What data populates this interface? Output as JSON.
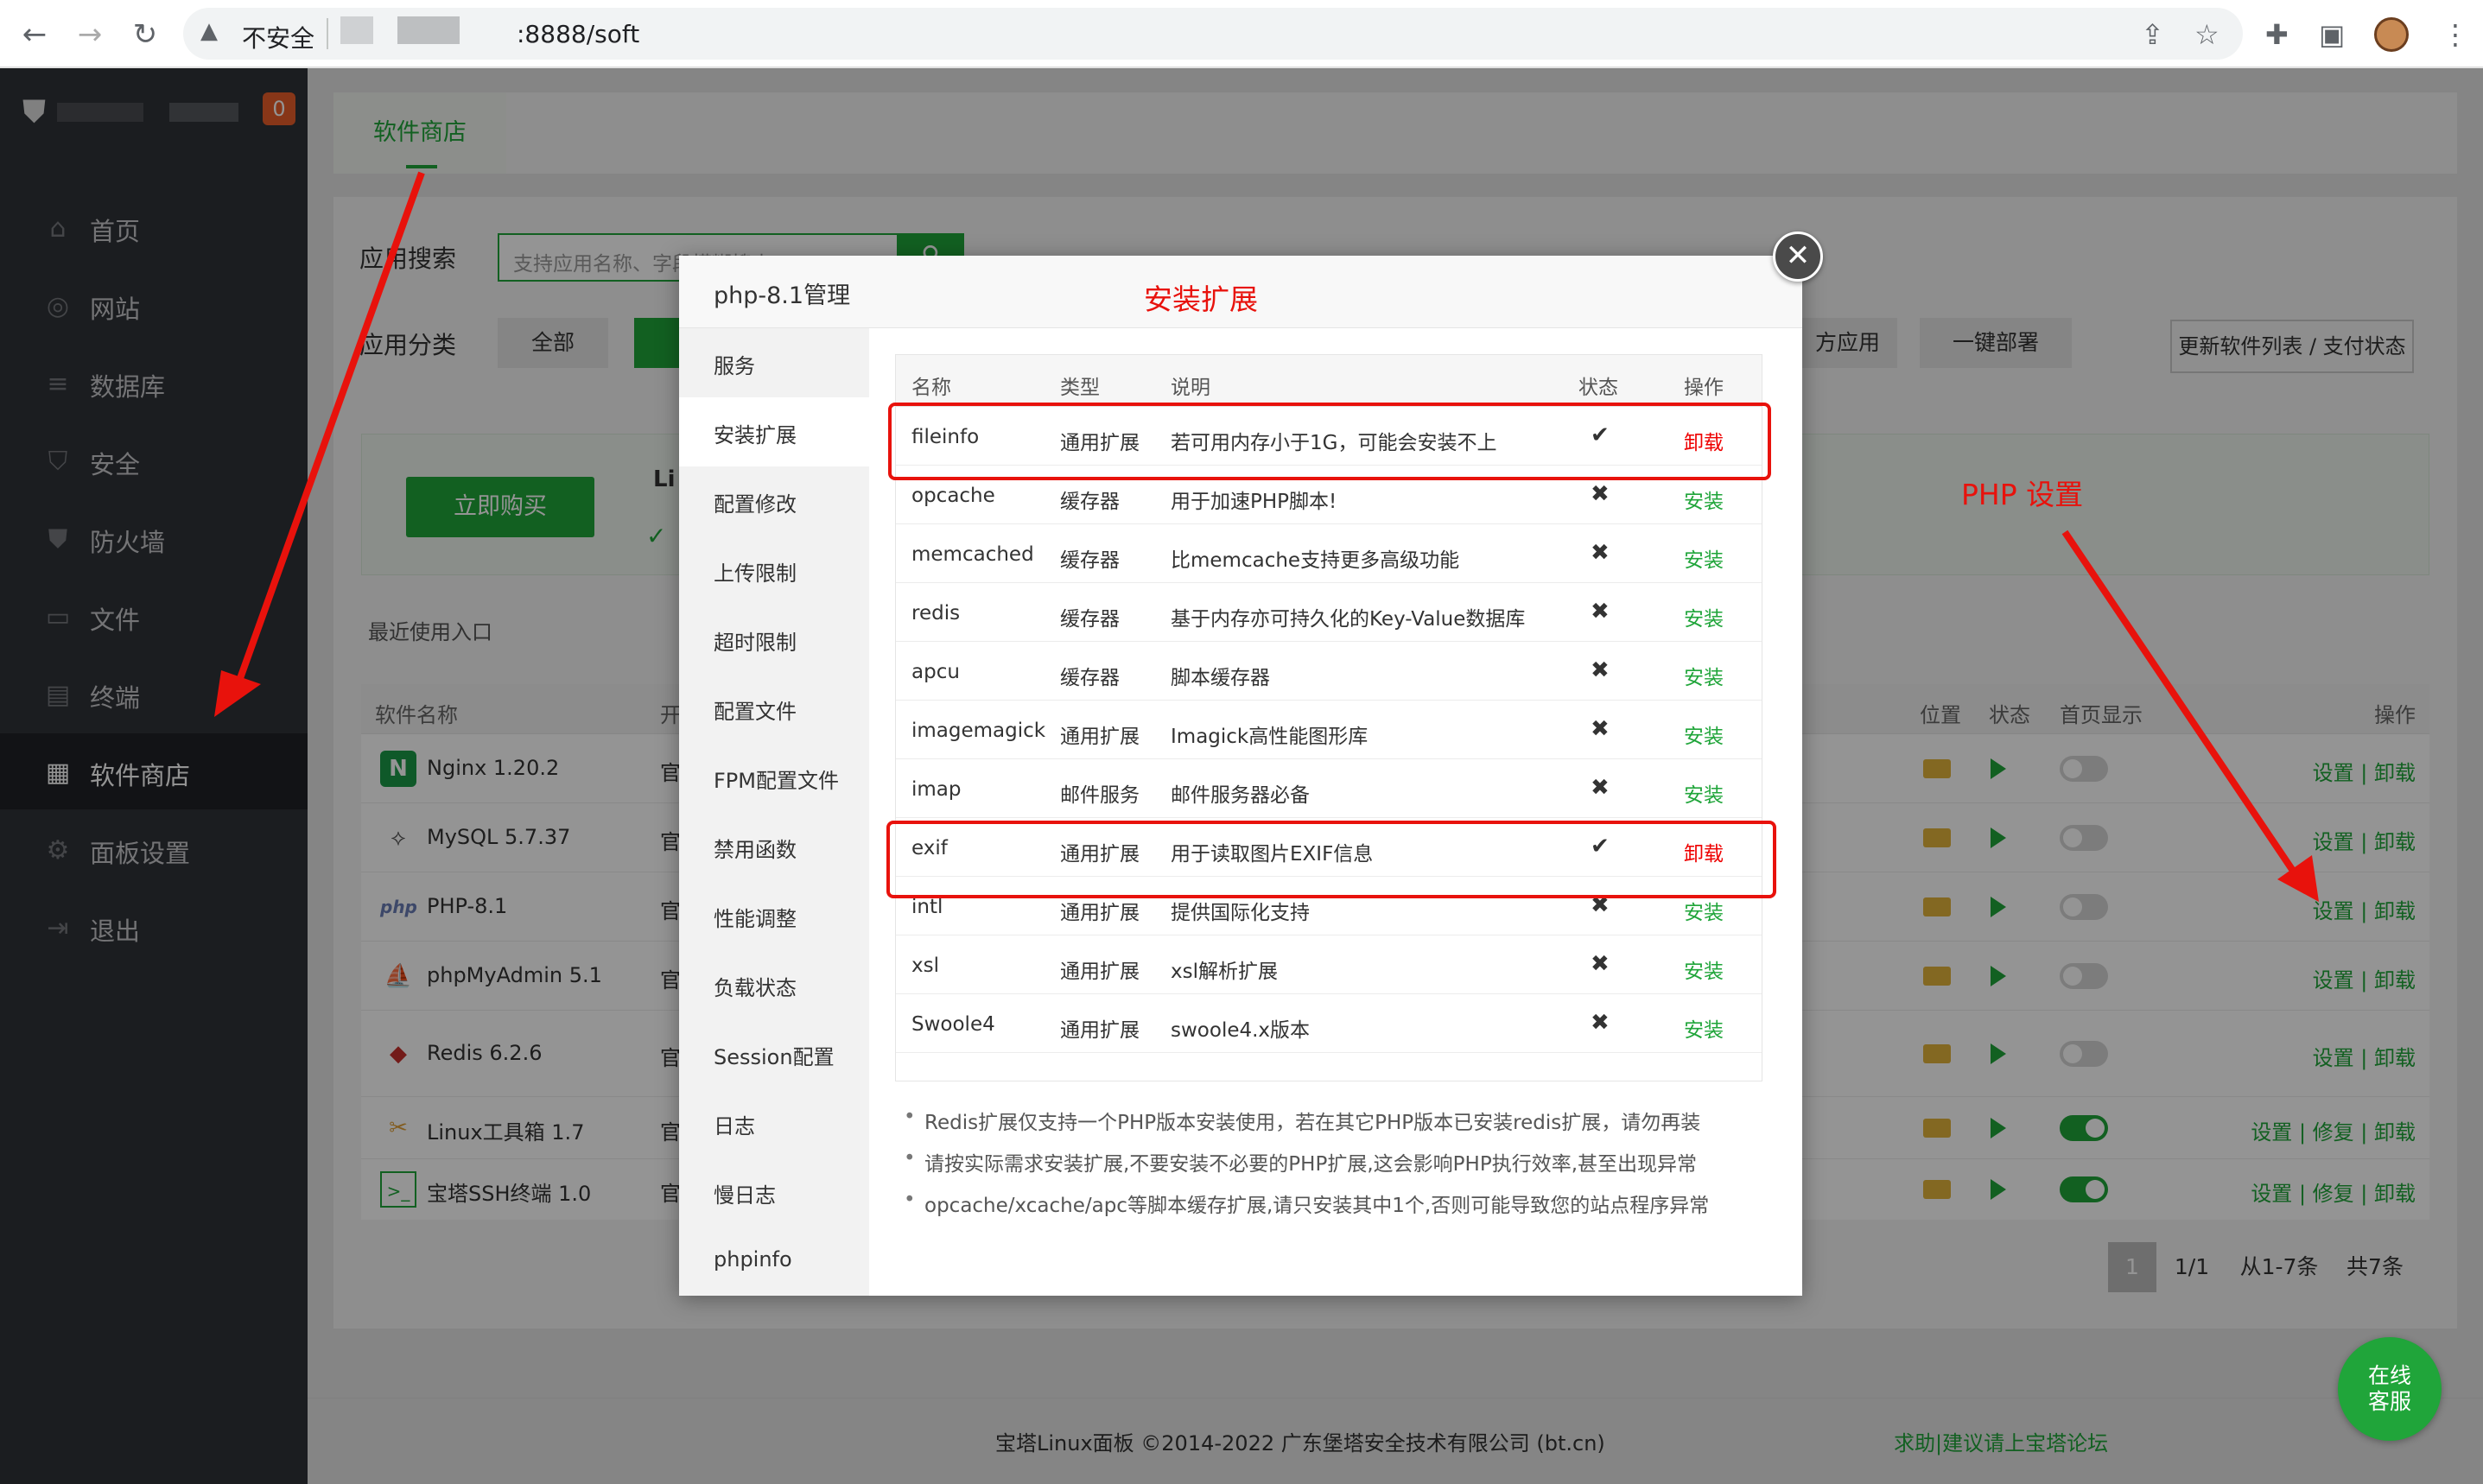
{
  "browser": {
    "insecure_label": "不安全",
    "url": ":8888/soft"
  },
  "sidebar": {
    "badge": "0",
    "items": [
      {
        "label": "首页",
        "icon": "home-icon"
      },
      {
        "label": "网站",
        "icon": "globe-icon"
      },
      {
        "label": "数据库",
        "icon": "database-icon"
      },
      {
        "label": "安全",
        "icon": "shield-icon"
      },
      {
        "label": "防火墙",
        "icon": "firewall-icon"
      },
      {
        "label": "文件",
        "icon": "folder-icon"
      },
      {
        "label": "终端",
        "icon": "terminal-icon"
      },
      {
        "label": "软件商店",
        "icon": "grid-icon",
        "active": true
      },
      {
        "label": "面板设置",
        "icon": "gear-icon"
      },
      {
        "label": "退出",
        "icon": "logout-icon"
      }
    ]
  },
  "main": {
    "tab": "软件商店",
    "search_label": "应用搜索",
    "search_placeholder": "支持应用名称、字段模糊搜索",
    "category_label": "应用分类",
    "category_all": "全部",
    "category_third": "方应用",
    "category_deploy": "一键部署",
    "update_button": "更新软件列表 / 支付状态",
    "buy_button": "立即购买",
    "promo_prefix": "Li",
    "recent_label": "最近使用入口",
    "table_headers": {
      "name": "软件名称",
      "dev": "开",
      "location": "位置",
      "status": "状态",
      "homepage": "首页显示",
      "ops": "操作"
    },
    "software": [
      {
        "name": "Nginx 1.20.2",
        "org": "官",
        "icon": "nginx-icon",
        "toggle_on": false,
        "ops": "设置 | 卸载"
      },
      {
        "name": "MySQL 5.7.37",
        "org": "官",
        "icon": "mysql-icon",
        "toggle_on": false,
        "ops": "设置 | 卸载"
      },
      {
        "name": "PHP-8.1",
        "org": "官",
        "icon": "php-icon",
        "toggle_on": false,
        "ops": "设置 | 卸载"
      },
      {
        "name": "phpMyAdmin 5.1",
        "org": "官",
        "icon": "phpmyadmin-icon",
        "toggle_on": false,
        "ops": "设置 | 卸载"
      },
      {
        "name": "Redis 6.2.6",
        "org": "官",
        "icon": "redis-icon",
        "toggle_on": false,
        "ops": "设置 | 卸载"
      },
      {
        "name": "Linux工具箱 1.7",
        "org": "官",
        "icon": "toolbox-icon",
        "toggle_on": true,
        "ops": "设置 | 修复 | 卸载"
      },
      {
        "name": "宝塔SSH终端 1.0",
        "org": "官",
        "icon": "terminal-icon",
        "toggle_on": true,
        "ops": "设置 | 修复 | 卸载"
      }
    ],
    "pager": {
      "current": "1",
      "pages": "1/1",
      "range": "从1-7条",
      "total": "共7条"
    }
  },
  "footer": {
    "copyright": "宝塔Linux面板 ©2014-2022 广东堡塔安全技术有限公司 (bt.cn)",
    "link": "求助|建议请上宝塔论坛"
  },
  "chat": {
    "line1": "在线",
    "line2": "客服"
  },
  "modal": {
    "title": "php-8.1管理",
    "close": "×",
    "nav": [
      "服务",
      "安装扩展",
      "配置修改",
      "上传限制",
      "超时限制",
      "配置文件",
      "FPM配置文件",
      "禁用函数",
      "性能调整",
      "负载状态",
      "Session配置",
      "日志",
      "慢日志",
      "phpinfo"
    ],
    "active_nav": "安装扩展",
    "headers": {
      "name": "名称",
      "type": "类型",
      "desc": "说明",
      "status": "状态",
      "op": "操作"
    },
    "extensions": [
      {
        "name": "fileinfo",
        "type": "通用扩展",
        "desc": "若可用内存小于1G，可能会安装不上",
        "installed": true,
        "status": "✔",
        "op": "卸载"
      },
      {
        "name": "opcache",
        "type": "缓存器",
        "desc": "用于加速PHP脚本!",
        "installed": false,
        "status": "✖",
        "op": "安装"
      },
      {
        "name": "memcached",
        "type": "缓存器",
        "desc": "比memcache支持更多高级功能",
        "installed": false,
        "status": "✖",
        "op": "安装"
      },
      {
        "name": "redis",
        "type": "缓存器",
        "desc": "基于内存亦可持久化的Key-Value数据库",
        "installed": false,
        "status": "✖",
        "op": "安装"
      },
      {
        "name": "apcu",
        "type": "缓存器",
        "desc": "脚本缓存器",
        "installed": false,
        "status": "✖",
        "op": "安装"
      },
      {
        "name": "imagemagick",
        "type": "通用扩展",
        "desc": "Imagick高性能图形库",
        "installed": false,
        "status": "✖",
        "op": "安装"
      },
      {
        "name": "imap",
        "type": "邮件服务",
        "desc": "邮件服务器必备",
        "installed": false,
        "status": "✖",
        "op": "安装"
      },
      {
        "name": "exif",
        "type": "通用扩展",
        "desc": "用于读取图片EXIF信息",
        "installed": true,
        "status": "✔",
        "op": "卸载"
      },
      {
        "name": "intl",
        "type": "通用扩展",
        "desc": "提供国际化支持",
        "installed": false,
        "status": "✖",
        "op": "安装"
      },
      {
        "name": "xsl",
        "type": "通用扩展",
        "desc": "xsl解析扩展",
        "installed": false,
        "status": "✖",
        "op": "安装"
      },
      {
        "name": "Swoole4",
        "type": "通用扩展",
        "desc": "swoole4.x版本",
        "installed": false,
        "status": "✖",
        "op": "安装"
      }
    ],
    "tips": [
      "Redis扩展仅支持一个PHP版本安装使用，若在其它PHP版本已安装redis扩展，请勿再装",
      "请按实际需求安装扩展,不要安装不必要的PHP扩展,这会影响PHP执行效率,甚至出现异常",
      "opcache/xcache/apc等脚本缓存扩展,请只安装其中1个,否则可能导致您的站点程序异常"
    ]
  },
  "annotations": {
    "install_ext": "安装扩展",
    "php_settings": "PHP 设置",
    "color": "#e8120c"
  },
  "colors": {
    "accent": "#20a53a",
    "sidebar": "#2f3237",
    "danger": "#e00"
  }
}
